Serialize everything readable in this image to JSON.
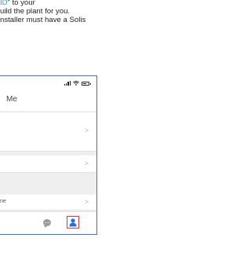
{
  "instructions": {
    "line1_highlight": "ID",
    "line1_text": "” to your",
    "line2": "uild the plant for you.",
    "line3": "nstaller must have a Solis"
  },
  "phone": {
    "nav_title": "Me",
    "rows": {
      "name_label": "ne"
    },
    "chevron": ">"
  },
  "colors": {
    "highlight": "#2da0e8",
    "frame": "#3a73c9",
    "callout": "#e53333",
    "active_tab": "#1f6fe0"
  },
  "icons": {
    "signal": "signal-icon",
    "wifi": "wifi-icon",
    "battery": "battery-icon",
    "chat": "chat-icon",
    "me": "person-icon"
  }
}
